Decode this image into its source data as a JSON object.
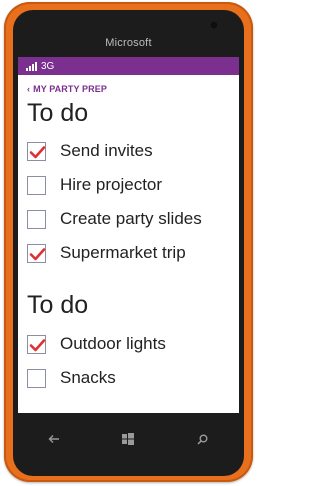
{
  "device": {
    "brand": "Microsoft"
  },
  "status_bar": {
    "network": "3G"
  },
  "breadcrumb": {
    "label": "MY PARTY PREP"
  },
  "lists": [
    {
      "title": "To do",
      "items": [
        {
          "label": "Send invites",
          "checked": true
        },
        {
          "label": "Hire projector",
          "checked": false
        },
        {
          "label": "Create party slides",
          "checked": false
        },
        {
          "label": "Supermarket trip",
          "checked": true
        }
      ]
    },
    {
      "title": "To do",
      "items": [
        {
          "label": "Outdoor lights",
          "checked": true
        },
        {
          "label": "Snacks",
          "checked": false
        }
      ]
    }
  ],
  "nav": {
    "back_icon": "back-arrow-icon",
    "start_icon": "windows-start-icon",
    "search_icon": "search-icon"
  },
  "colors": {
    "device_orange": "#e8701d",
    "accent_purple": "#7b2f8f",
    "check_red": "#e03131"
  }
}
